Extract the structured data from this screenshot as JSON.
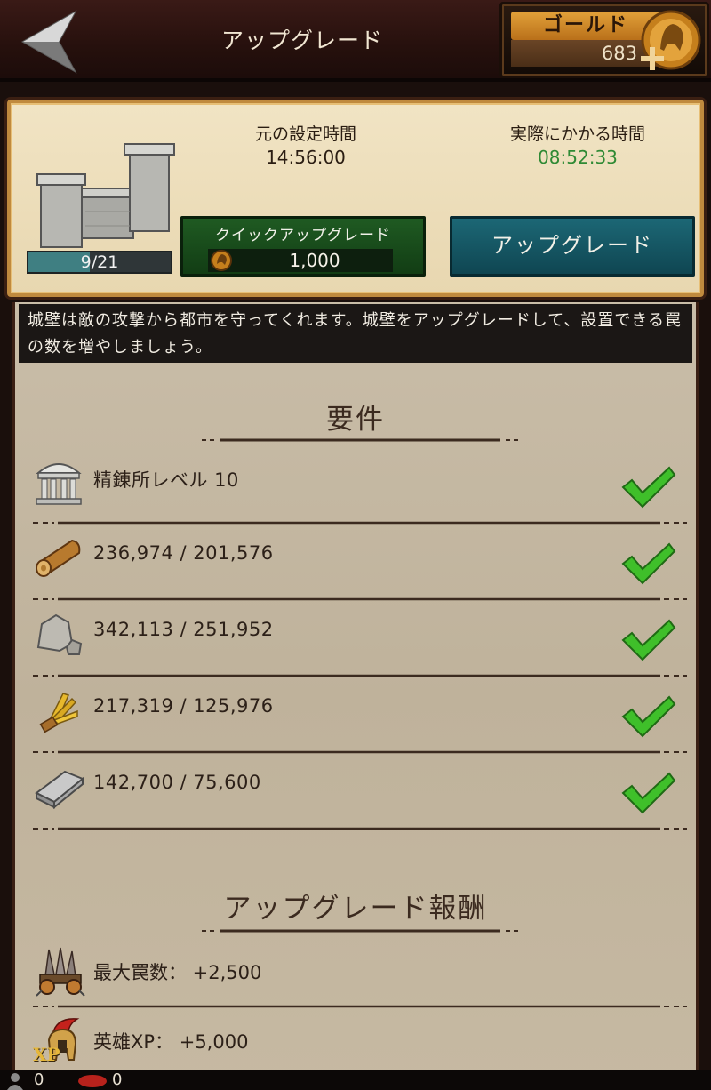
{
  "header": {
    "title": "アップグレード",
    "gold_label": "ゴールド",
    "gold_value": "683"
  },
  "building": {
    "level": "9/21",
    "original_time_label": "元の設定時間",
    "original_time": "14:56:00",
    "actual_time_label": "実際にかかる時間",
    "actual_time": "08:52:33",
    "quick_upgrade_label": "クイックアップグレード",
    "quick_upgrade_price": "1,000",
    "upgrade_label": "アップグレード"
  },
  "description": "城壁は敵の攻撃から都市を守ってくれます。城壁をアップグレードして、設置できる罠の数を増やしましょう。",
  "requirements": {
    "title": "要件",
    "items": [
      {
        "icon": "refinery-icon",
        "text": "精錬所レベル 10",
        "met": true
      },
      {
        "icon": "wood-icon",
        "text": "236,974 / 201,576",
        "met": true
      },
      {
        "icon": "stone-icon",
        "text": "342,113 / 251,952",
        "met": true
      },
      {
        "icon": "food-icon",
        "text": "217,319 / 125,976",
        "met": true
      },
      {
        "icon": "ore-icon",
        "text": "142,700 / 75,600",
        "met": true
      }
    ]
  },
  "rewards": {
    "title": "アップグレード報酬",
    "items": [
      {
        "icon": "trap-icon",
        "text": "最大罠数： +2,500"
      },
      {
        "icon": "hero-xp-icon",
        "text": "英雄XP： +5,000",
        "badge": "XP"
      }
    ]
  },
  "bottom": {
    "count_a": "0",
    "count_b": "0"
  },
  "colors": {
    "gold": "#e2a13a",
    "quick_green": "#1f5a22",
    "upgrade_teal": "#1c6775",
    "time_green": "#2f8a34",
    "check_green": "#3fbf2a"
  }
}
